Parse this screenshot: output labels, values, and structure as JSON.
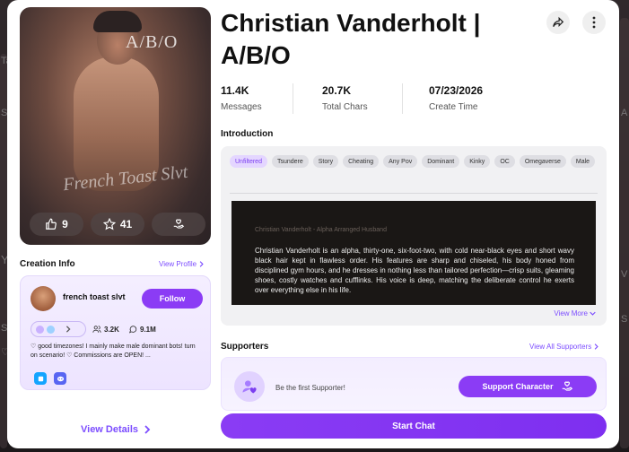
{
  "background": {
    "side_labels": [
      "Ta",
      "Y",
      "S",
      "S",
      "A",
      "V",
      "S",
      "♡"
    ]
  },
  "character": {
    "name": "Christian Vanderholt | A/B/O",
    "cover_watermark": "A/B/O",
    "cover_signature": "French Toast Slvt",
    "likes": "9",
    "stars": "41"
  },
  "stats": [
    {
      "value": "11.4K",
      "label": "Messages"
    },
    {
      "value": "20.7K",
      "label": "Total Chars"
    },
    {
      "value": "07/23/2026",
      "label": "Create Time"
    }
  ],
  "introduction": {
    "heading": "Introduction",
    "tags": [
      "Unfiltered",
      "Tsundere",
      "Story",
      "Cheating",
      "Any Pov",
      "Dominant",
      "Kinky",
      "OC",
      "Omegaverse",
      "Male"
    ],
    "subtitle": "Christian Vanderholt - Alpha Arranged Husband",
    "text": "Christian Vanderholt is an alpha, thirty-one, six-foot-two, with cold near-black eyes and short wavy black hair kept in flawless order. His features are sharp and chiseled, his body honed from disciplined gym hours, and he dresses in nothing less than tailored perfection—crisp suits, gleaming shoes, costly watches and cufflinks. His voice is deep, matching the deliberate control he exerts over everything else in his life.",
    "view_more": "View More"
  },
  "creation_info": {
    "heading": "Creation Info",
    "view_profile": "View Profile",
    "creator_name": "french toast slvt",
    "follow_label": "Follow",
    "followers": "3.2K",
    "chats": "9.1M",
    "bio": "♡ good timezones! I mainly make male dominant bots! turn on scenario! ♡  Commissions are OPEN! ...",
    "view_details": "View Details"
  },
  "supporters": {
    "heading": "Supporters",
    "view_all": "View All Supporters",
    "empty_message": "Be the first Supporter!",
    "support_button": "Support Character"
  },
  "actions": {
    "start_chat": "Start Chat"
  },
  "colors": {
    "accent": "#8b3cf5",
    "link": "#7c4dff"
  }
}
